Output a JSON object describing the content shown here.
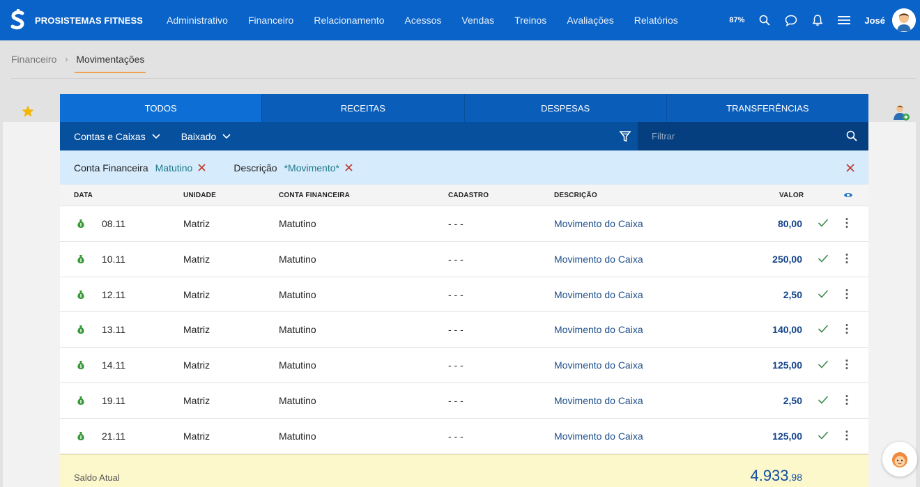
{
  "app": {
    "brand": "PROSISTEMAS FITNESS"
  },
  "nav": {
    "items": [
      "Administrativo",
      "Financeiro",
      "Relacionamento",
      "Acessos",
      "Vendas",
      "Treinos",
      "Avaliações",
      "Relatórios"
    ]
  },
  "top_right": {
    "zoom": "87%",
    "user_name": "José"
  },
  "breadcrumb": {
    "parent": "Financeiro",
    "current": "Movimentações"
  },
  "tabs": [
    {
      "label": "TODOS",
      "active": true
    },
    {
      "label": "RECEITAS",
      "active": false
    },
    {
      "label": "DESPESAS",
      "active": false
    },
    {
      "label": "TRANSFERÊNCIAS",
      "active": false
    }
  ],
  "filters": {
    "dropdown_accounts": "Contas e Caixas",
    "dropdown_status": "Baixado",
    "search_placeholder": "Filtrar"
  },
  "chips": [
    {
      "label": "Conta Financeira",
      "value": "Matutino"
    },
    {
      "label": "Descrição",
      "value": "*Movimento*"
    }
  ],
  "table": {
    "headers": {
      "data": "DATA",
      "unidade": "UNIDADE",
      "conta": "CONTA FINANCEIRA",
      "cadastro": "CADASTRO",
      "descricao": "DESCRIÇÃO",
      "valor": "VALOR"
    },
    "rows": [
      {
        "data": "08.11",
        "unidade": "Matriz",
        "conta": "Matutino",
        "cadastro": "- - -",
        "descricao": "Movimento do Caixa",
        "valor": "80,00"
      },
      {
        "data": "10.11",
        "unidade": "Matriz",
        "conta": "Matutino",
        "cadastro": "- - -",
        "descricao": "Movimento do Caixa",
        "valor": "250,00"
      },
      {
        "data": "12.11",
        "unidade": "Matriz",
        "conta": "Matutino",
        "cadastro": "- - -",
        "descricao": "Movimento do Caixa",
        "valor": "2,50"
      },
      {
        "data": "13.11",
        "unidade": "Matriz",
        "conta": "Matutino",
        "cadastro": "- - -",
        "descricao": "Movimento do Caixa",
        "valor": "140,00"
      },
      {
        "data": "14.11",
        "unidade": "Matriz",
        "conta": "Matutino",
        "cadastro": "- - -",
        "descricao": "Movimento do Caixa",
        "valor": "125,00"
      },
      {
        "data": "19.11",
        "unidade": "Matriz",
        "conta": "Matutino",
        "cadastro": "- - -",
        "descricao": "Movimento do Caixa",
        "valor": "2,50"
      },
      {
        "data": "21.11",
        "unidade": "Matriz",
        "conta": "Matutino",
        "cadastro": "- - -",
        "descricao": "Movimento do Caixa",
        "valor": "125,00"
      }
    ]
  },
  "footer": {
    "label": "Saldo Atual",
    "value_int": "4.933",
    "value_dec": ",98"
  },
  "colors": {
    "nav_blue": "#0a63c8",
    "tab_blue": "#0a5db9",
    "filter_blue": "#07509e",
    "income_green": "#3a9a3a",
    "close_red": "#c0392b",
    "accent_orange": "#f0a14e"
  },
  "icons": {
    "row_type": "money-bag-icon",
    "row_status": "check-icon",
    "row_menu": "kebab-menu-icon"
  }
}
